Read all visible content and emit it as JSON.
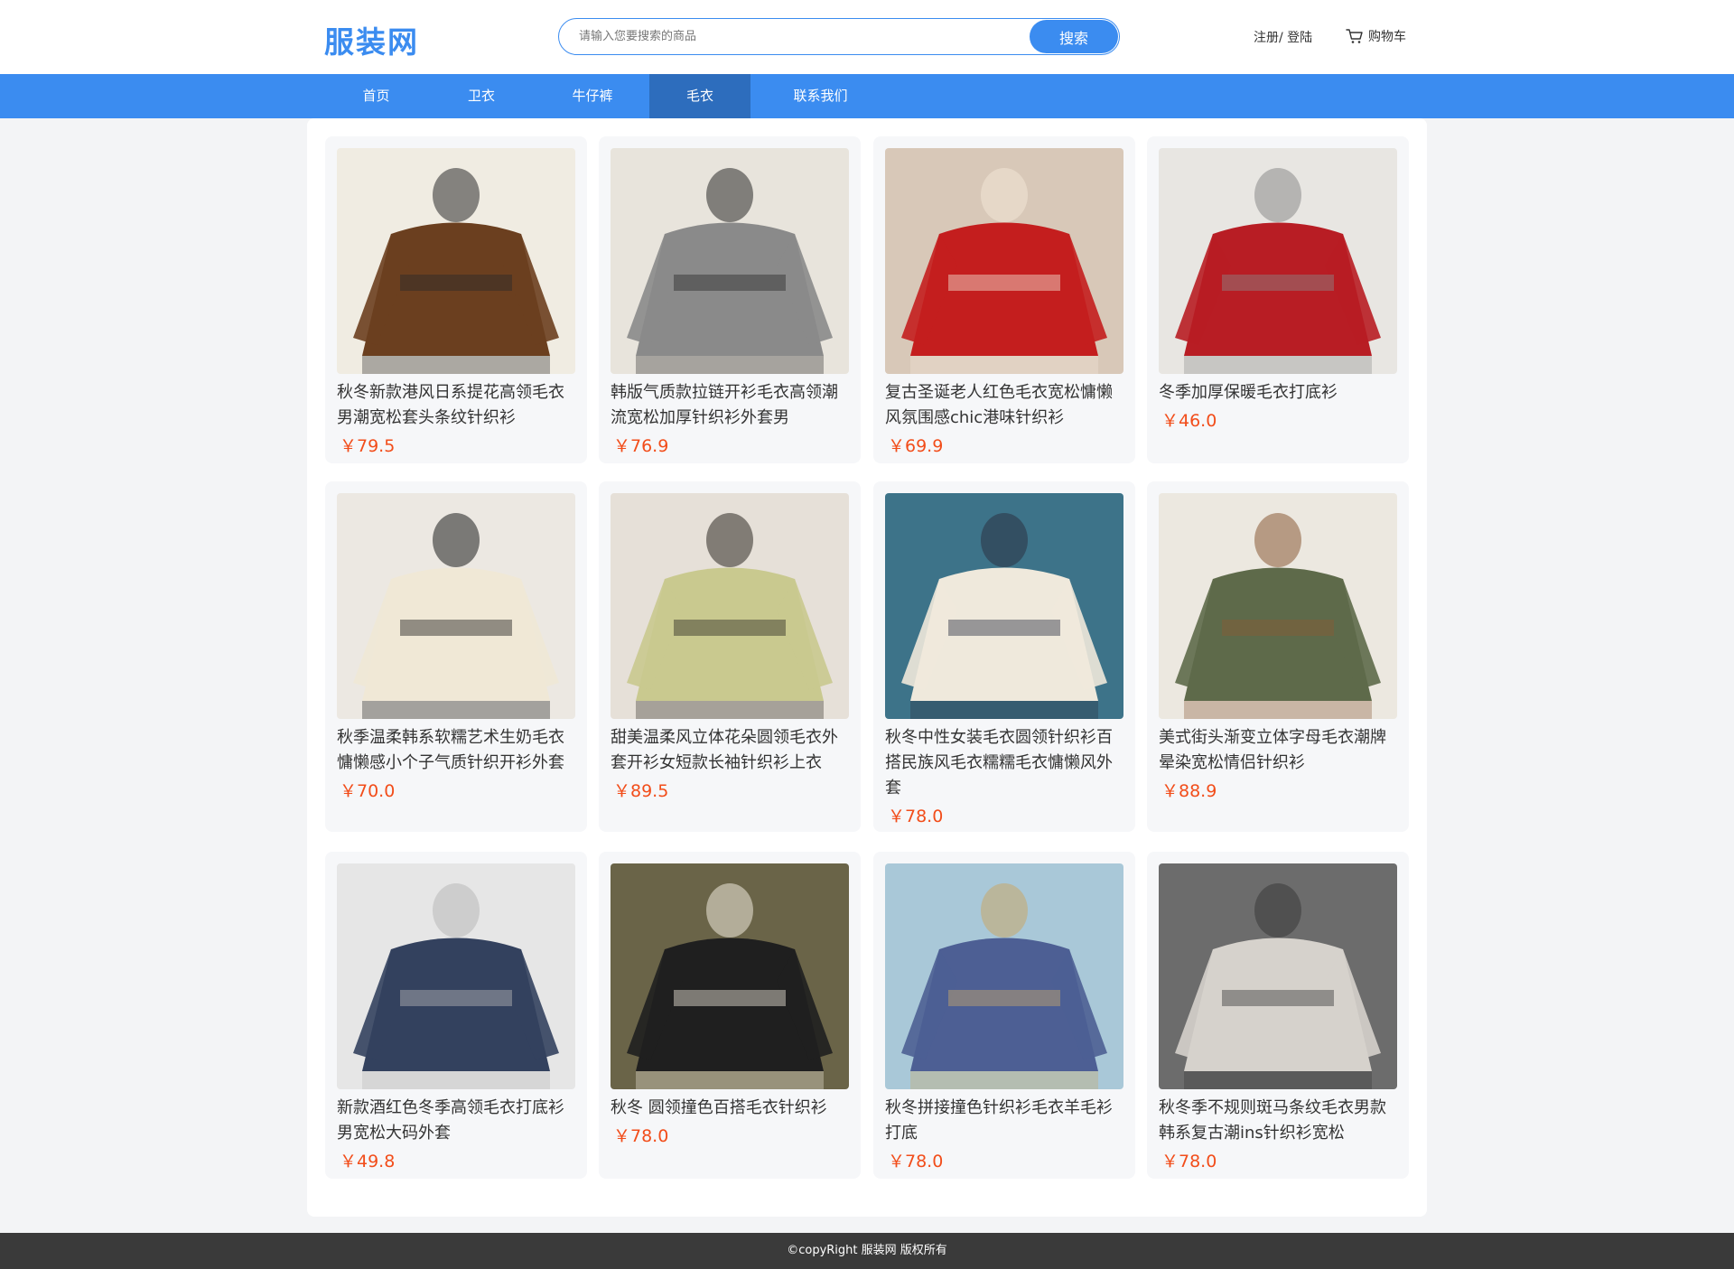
{
  "header": {
    "logo": "服装网",
    "search_placeholder": "请输入您要搜索的商品",
    "search_button": "搜索",
    "account": "注册/ 登陆",
    "cart": "购物车"
  },
  "nav": {
    "items": [
      {
        "label": "首页"
      },
      {
        "label": "卫衣"
      },
      {
        "label": "牛仔裤"
      },
      {
        "label": "毛衣",
        "active": true
      },
      {
        "label": "联系我们"
      }
    ]
  },
  "products": [
    {
      "title": "秋冬新款港风日系提花高领毛衣男潮宽松套头条纹针织衫",
      "price": "￥79.5",
      "colors": [
        "#f0ece2",
        "#6b3f1f",
        "#2b2b2b"
      ]
    },
    {
      "title": "韩版气质款拉链开衫毛衣高领潮流宽松加厚针织衫外套男",
      "price": "￥76.9",
      "colors": [
        "#e8e4dc",
        "#8a8a8a",
        "#2a2a2a"
      ]
    },
    {
      "title": "复古圣诞老人红色毛衣宽松慵懒风氛围感chic港味针织衫",
      "price": "￥69.9",
      "colors": [
        "#d8c8b8",
        "#c41e1e",
        "#f3e6d6"
      ]
    },
    {
      "title": "冬季加厚保暖毛衣打底衫",
      "price": "￥46.0",
      "colors": [
        "#e8e6e2",
        "#b81d24",
        "#8a8a8a"
      ]
    },
    {
      "title": "秋季温柔韩系软糯艺术生奶毛衣慵懒感小个子气质针织开衫外套",
      "price": "￥70.0",
      "colors": [
        "#ece8e2",
        "#f0e8d6",
        "#1d1d1d"
      ]
    },
    {
      "title": "甜美温柔风立体花朵圆领毛衣外套开衫女短款长袖针织衫上衣",
      "price": "￥89.5",
      "colors": [
        "#e6e0d8",
        "#c9c98f",
        "#2d2a24"
      ]
    },
    {
      "title": "秋冬中性女装毛衣圆领针织衫百搭民族风毛衣糯糯毛衣慵懒风外套",
      "price": "￥78.0",
      "colors": [
        "#3d7389",
        "#efe9dc",
        "#2c3142"
      ]
    },
    {
      "title": "美式街头渐变立体字母毛衣潮牌晕染宽松情侣针织衫",
      "price": "￥88.9",
      "colors": [
        "#ece8e0",
        "#5e6a4a",
        "#8a5a36"
      ]
    },
    {
      "title": "新款酒红色冬季高领毛衣打底衫男宽松大码外套",
      "price": "￥49.8",
      "colors": [
        "#e6e6e6",
        "#33415e",
        "#b8b8b8"
      ]
    },
    {
      "title": "秋冬 圆领撞色百搭毛衣针织衫",
      "price": "￥78.0",
      "colors": [
        "#6a6448",
        "#1f1f1f",
        "#efe9dc"
      ]
    },
    {
      "title": "秋冬拼接撞色针织衫毛衣羊毛衫打底",
      "price": "￥78.0",
      "colors": [
        "#a9c8d8",
        "#4d5f94",
        "#c9a86a"
      ]
    },
    {
      "title": "秋冬季不规则斑马条纹毛衣男款韩系复古潮ins针织衫宽松",
      "price": "￥78.0",
      "colors": [
        "#6c6c6c",
        "#d6d2cc",
        "#3a3a3a"
      ]
    }
  ],
  "footer": {
    "text": "©copyRight 服装网 版权所有"
  }
}
